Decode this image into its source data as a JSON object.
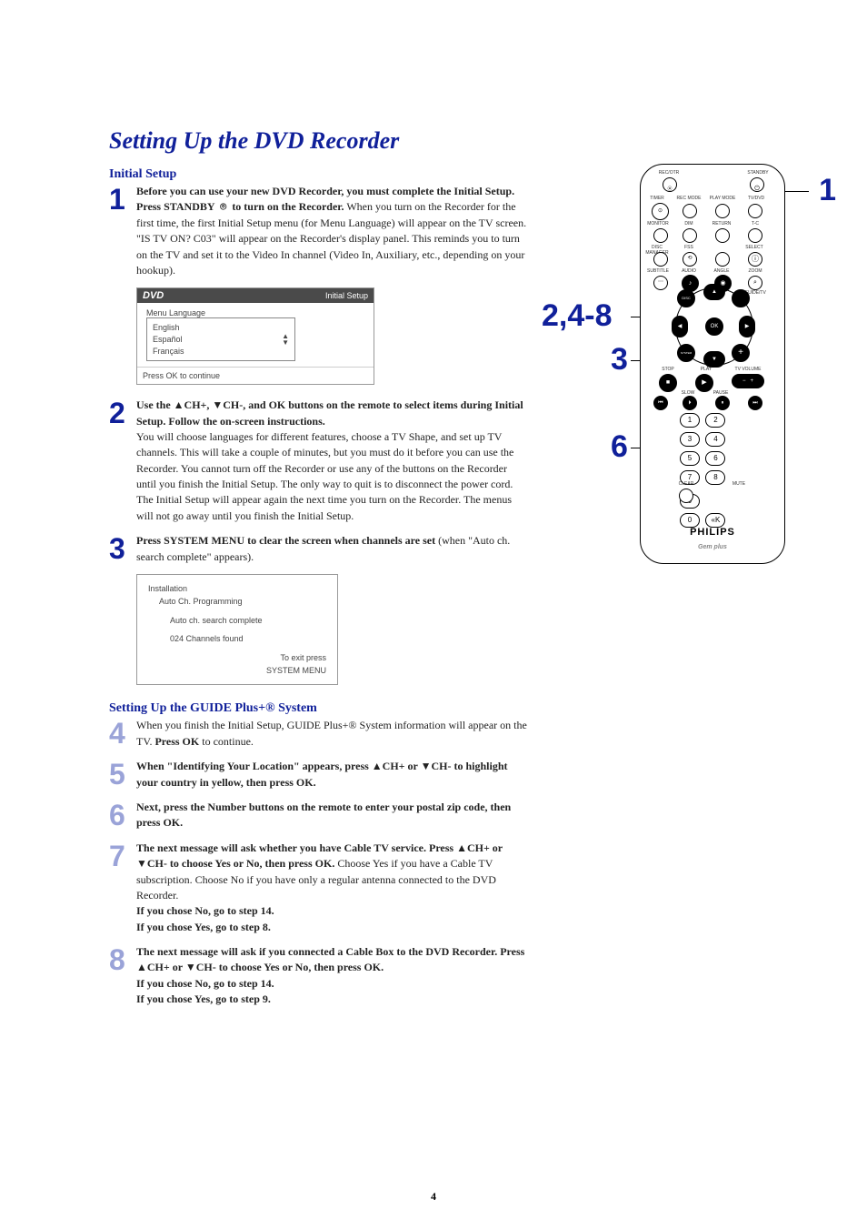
{
  "title": "Setting Up the DVD Recorder",
  "pagenum": "4",
  "sections": {
    "initial": {
      "heading": "Initial Setup",
      "step1": {
        "num": "1",
        "bold1": "Before you can use your new DVD Recorder, you must complete the Initial Setup.",
        "bold2": "Press STANDBY  ⌾  to turn on the Recorder.",
        "text": " When you turn on the Recorder for the first time, the first Initial Setup menu (for Menu Language) will appear on the TV screen.  \"IS TV ON? C03\" will appear on the Recorder's display panel.  This reminds you to turn on the TV and set it to the Video In channel (Video In, Auxiliary, etc., depending on your hookup)."
      },
      "osd1": {
        "logo": "DVD",
        "title": "Initial Setup",
        "list_label": "Menu Language",
        "items": [
          "English",
          "Español",
          "Français"
        ],
        "footer": "Press OK to continue"
      },
      "step2": {
        "num": "2",
        "bold1": "Use the ▲CH+, ▼CH-, and OK buttons on the remote to select items during Initial Setup. Follow the on-screen instructions.",
        "text": "You will choose languages for different features, choose a TV Shape, and set up TV channels.  This will take a couple of minutes, but you must do it before you can use the Recorder.  You cannot turn off the Recorder or use any of the buttons on the Recorder until you finish the Initial Setup. The only way to quit is to disconnect the power cord. The Initial Setup will appear again the next time you turn on the Recorder. The menus will not go away until you finish the Initial Setup."
      },
      "step3": {
        "num": "3",
        "bold1": "Press SYSTEM MENU to clear the screen when channels are set",
        "text": " (when \"Auto ch. search complete\" appears)."
      },
      "osd2": {
        "line1": "Installation",
        "line2": "Auto Ch. Programming",
        "line3": "Auto ch. search complete",
        "line4": "024 Channels found",
        "line5a": "To exit press",
        "line5b": "SYSTEM MENU"
      }
    },
    "guide": {
      "heading": "Setting Up the GUIDE Plus+® System",
      "step4": {
        "num": "4",
        "text1": "When you finish the Initial Setup, GUIDE Plus+® System information will appear on the TV. ",
        "bold": "Press OK",
        "text2": " to continue."
      },
      "step5": {
        "num": "5",
        "bold": "When \"Identifying Your Location\" appears, press ▲CH+ or ▼CH- to highlight your country in yellow, then press OK."
      },
      "step6": {
        "num": "6",
        "bold": "Next, press the Number buttons on the remote to enter your postal zip code, then press OK."
      },
      "step7": {
        "num": "7",
        "bold1": "The next message will ask whether you have Cable TV service. Press ▲CH+ or ▼CH- to choose Yes or No, then press OK.",
        "text": " Choose Yes if you have a Cable TV subscription. Choose No if you have only a regular antenna connected to the DVD Recorder.",
        "bold2": "If you chose No, go to step 14.",
        "bold3": "If you chose Yes, go to step 8."
      },
      "step8": {
        "num": "8",
        "bold1": "The next message will ask if you connected a Cable Box to the DVD Recorder. Press ▲CH+ or ▼CH- to choose Yes or No, then press OK.",
        "bold2": "If you chose No, go to step 14.",
        "bold3": "If you chose Yes, go to step 9."
      }
    }
  },
  "remote": {
    "top_labels": [
      "REC/OTR",
      "STANDBY"
    ],
    "row2_labels": [
      "TIMER",
      "REC MODE",
      "PLAY MODE",
      "TV/DVD"
    ],
    "row3_labels": [
      "MONITOR",
      "DIM",
      "RETURN",
      "T-C"
    ],
    "row4_labels": [
      "DISC MANAGER",
      "FSS",
      "",
      "SELECT"
    ],
    "row5_labels": [
      "SUBTITLE",
      "AUDIO",
      "ANGLE",
      "ZOOM"
    ],
    "row6_labels": [
      "",
      "",
      "",
      "GUIDE/TV"
    ],
    "dpad": {
      "up": "CH+",
      "down": "CH-",
      "left": "◀",
      "right": "▶",
      "ok": "OK",
      "tl": "DISC",
      "tr": "",
      "bl": "SYSTEM",
      "br": ""
    },
    "play_row": [
      "STOP",
      "PLAY",
      "TV VOLUME"
    ],
    "slow_row": [
      "",
      "SLOW",
      "PAUSE",
      ""
    ],
    "numbers": [
      "1",
      "2",
      "3",
      "4",
      "5",
      "6",
      "7",
      "8",
      "9",
      "",
      "0",
      "«K"
    ],
    "bottom_labels": [
      "CLEAR",
      "",
      "MUTE"
    ],
    "logo": "PHILIPS",
    "gemstar": "Gem plus"
  },
  "callouts": {
    "c1": "1",
    "c248": "2,4-8",
    "c3": "3",
    "c6": "6"
  }
}
